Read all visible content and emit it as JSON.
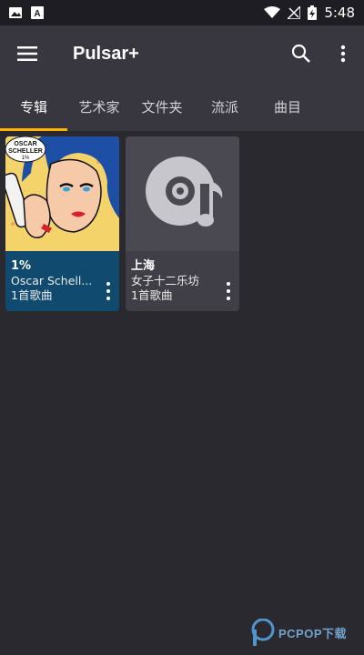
{
  "status_bar": {
    "time": "5:48",
    "icons": [
      "image-icon",
      "text-a-icon",
      "wifi-icon",
      "no-signal-icon",
      "battery-charging-icon"
    ]
  },
  "app_bar": {
    "title": "Pulsar+",
    "menu_icon": "hamburger-menu-icon",
    "search_icon": "search-icon",
    "more_icon": "more-vert-icon"
  },
  "tabs": [
    {
      "label": "专辑",
      "active": true
    },
    {
      "label": "艺术家",
      "active": false
    },
    {
      "label": "文件夹",
      "active": false
    },
    {
      "label": "流派",
      "active": false
    },
    {
      "label": "曲目",
      "active": false
    }
  ],
  "albums": [
    {
      "title": "1%",
      "artist": "Oscar Schell...",
      "count": "1首歌曲",
      "art_text": "OSCAR SCHELLER 1%",
      "bg": "#104a6e"
    },
    {
      "title": "上海",
      "artist": "女子十二乐坊",
      "count": "1首歌曲",
      "art_icon": "album-music-placeholder-icon",
      "bg": "#403f47"
    }
  ],
  "watermark": {
    "text": "PCPOP下载"
  },
  "colors": {
    "background": "#2a2930",
    "toolbar": "#38373f",
    "tab_indicator": "#ffb300",
    "album_card_1": "#104a6e",
    "album_card_2": "#403f47"
  }
}
